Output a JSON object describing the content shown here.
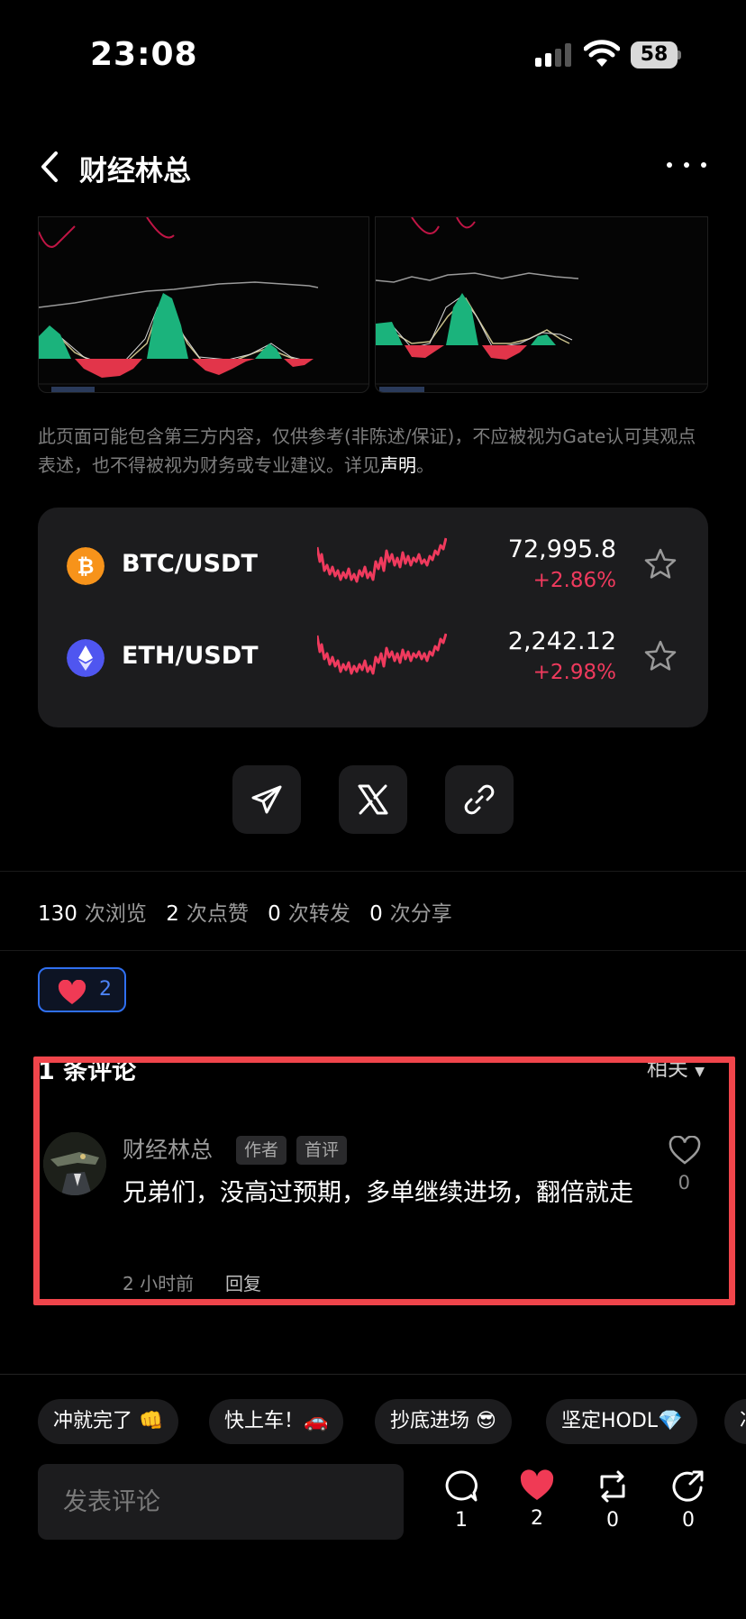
{
  "status_bar": {
    "time": "23:08",
    "battery": "58"
  },
  "header": {
    "title": "财经林总"
  },
  "disclaimer": {
    "text": "此页面可能包含第三方内容，仅供参考(非陈述/保证)，不应被视为Gate认可其观点表述，也不得被视为财务或专业建议。详见",
    "link": "声明",
    "end": "。"
  },
  "markets": [
    {
      "pair": "BTC/USDT",
      "price": "72,995.8",
      "change": "+2.86%",
      "icon": "bitcoin-icon",
      "color": "#f7931a"
    },
    {
      "pair": "ETH/USDT",
      "price": "2,242.12",
      "change": "+2.98%",
      "icon": "ethereum-icon",
      "color": "#4f56f0"
    }
  ],
  "stats": {
    "views_num": "130",
    "views_label": "次浏览",
    "likes_num": "2",
    "likes_label": "次点赞",
    "reposts_num": "0",
    "reposts_label": "次转发",
    "shares_num": "0",
    "shares_label": "次分享"
  },
  "reaction": {
    "count": "2"
  },
  "comments": {
    "title": "1 条评论",
    "sort": "相关",
    "items": [
      {
        "author": "财经林总",
        "badge_author": "作者",
        "badge_first": "首评",
        "text": "兄弟们，没高过预期，多单继续进场，翻倍就走",
        "time": "2 小时前",
        "reply": "回复",
        "likes": "0"
      }
    ]
  },
  "quick_replies": [
    "冲就完了 👊",
    "快上车！🚗",
    "抄底进场 😎",
    "坚定HODL💎",
    "冲"
  ],
  "composer": {
    "placeholder": "发表评论"
  },
  "actions": {
    "comments": "1",
    "likes": "2",
    "reposts": "0",
    "shares": "0"
  },
  "colors": {
    "up": "#ef3a5d",
    "accent_blue": "#2f6ff0",
    "highlight": "#f0454b"
  }
}
